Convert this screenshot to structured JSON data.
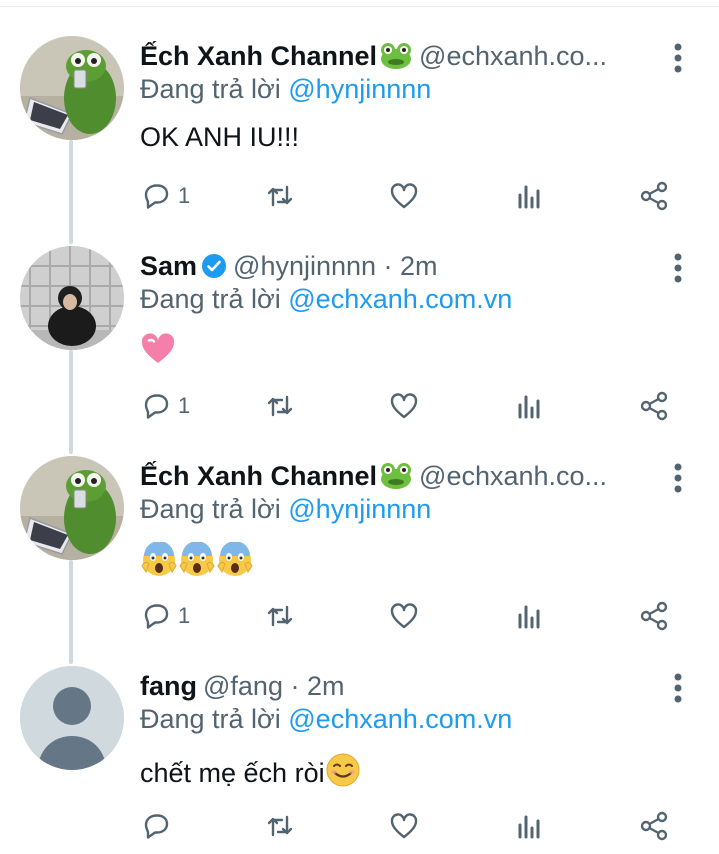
{
  "tweets": [
    {
      "name": "Ếch Xanh Channel",
      "handle": "@echxanh.co...",
      "reply_prefix": "Đang trả lời ",
      "reply_mention": "@hynjinnnn",
      "content": "OK ANH IU!!!",
      "reply_count": "1",
      "avatar": "kermit-avatar",
      "badge": "frog-emoji"
    },
    {
      "name": "Sam",
      "handle": "@hynjinnnn · 2m",
      "reply_prefix": "Đang trả lời ",
      "reply_mention": "@echxanh.com.vn",
      "content": "",
      "content_emoji": "pink-heart-emoji",
      "reply_count": "1",
      "avatar": "sam-avatar",
      "badge": "verified-icon"
    },
    {
      "name": "Ếch Xanh Channel",
      "handle": "@echxanh.co...",
      "reply_prefix": "Đang trả lời ",
      "reply_mention": "@hynjinnnn",
      "content": "",
      "content_emoji": "screaming-face-emoji x3",
      "reply_count": "1",
      "avatar": "kermit-avatar",
      "badge": "frog-emoji"
    },
    {
      "name": "fang",
      "handle": "@fang · 2m",
      "reply_prefix": "Đang trả lời ",
      "reply_mention": "@echxanh.com.vn",
      "content": "chết mẹ ếch ròi",
      "content_emoji": "smiling-face-emoji",
      "reply_count": "",
      "avatar": "default-avatar"
    }
  ],
  "colors": {
    "accent": "#1d9bf0",
    "secondary_text": "#536471",
    "thread_line": "#cfd9de"
  }
}
